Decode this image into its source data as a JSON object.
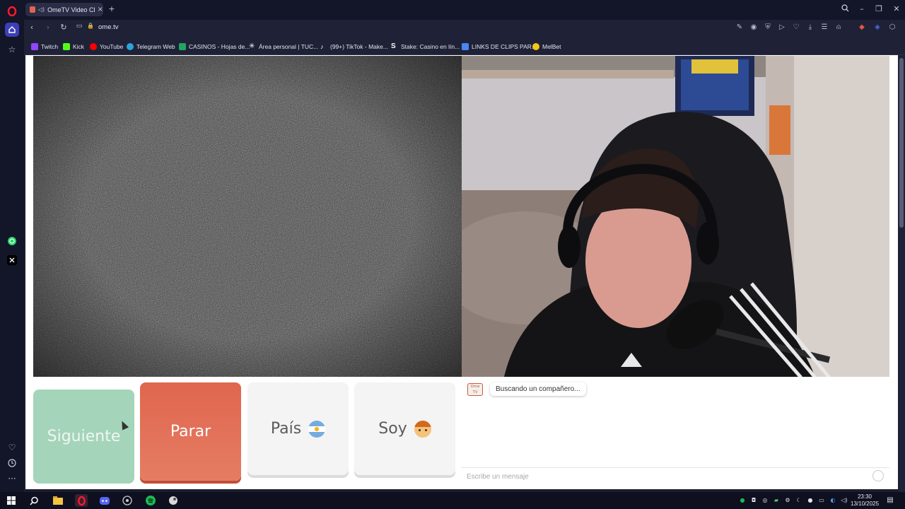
{
  "browser": {
    "tab_title": "OmeTV Video Chat -",
    "url": "ome.tv"
  },
  "bookmarks": [
    {
      "label": "Twitch",
      "icon": "twitch-icon",
      "color": "#9146ff"
    },
    {
      "label": "Kick",
      "icon": "kick-icon",
      "color": "#53fc18"
    },
    {
      "label": "YouTube",
      "icon": "youtube-icon",
      "color": "#ff0000"
    },
    {
      "label": "Telegram Web",
      "icon": "telegram-icon",
      "color": "#2aa3de"
    },
    {
      "label": "CASINOS - Hojas de...",
      "icon": "sheets-icon",
      "color": "#21a464"
    },
    {
      "label": "Área personal | TUC...",
      "icon": "tuc-icon",
      "color": "#ffffff"
    },
    {
      "label": "(99+) TikTok - Make...",
      "icon": "tiktok-icon",
      "color": "#ffffff"
    },
    {
      "label": "Stake: Casino en lín...",
      "icon": "stake-icon",
      "color": "#ffffff"
    },
    {
      "label": "LINKS DE CLIPS PAR...",
      "icon": "docs-icon",
      "color": "#4a86f5"
    },
    {
      "label": "MelBet",
      "icon": "melbet-icon",
      "color": "#f5c518"
    }
  ],
  "controls": {
    "next_label": "Siguiente",
    "stop_label": "Parar",
    "country_label": "País",
    "country_flag": "🇦🇷",
    "gender_label": "Soy",
    "gender_emoji": "👦"
  },
  "chat": {
    "logo_text": "Ome TV",
    "status_message": "Buscando un compañero...",
    "input_placeholder": "Escribe un mensaje"
  },
  "taskbar": {
    "time": "23:30",
    "date": "13/10/2025"
  },
  "colors": {
    "next_button": "#a4d4b9",
    "stop_button": "#e0664f",
    "neutral_button": "#f4f4f4",
    "browser_dark": "#131528"
  }
}
